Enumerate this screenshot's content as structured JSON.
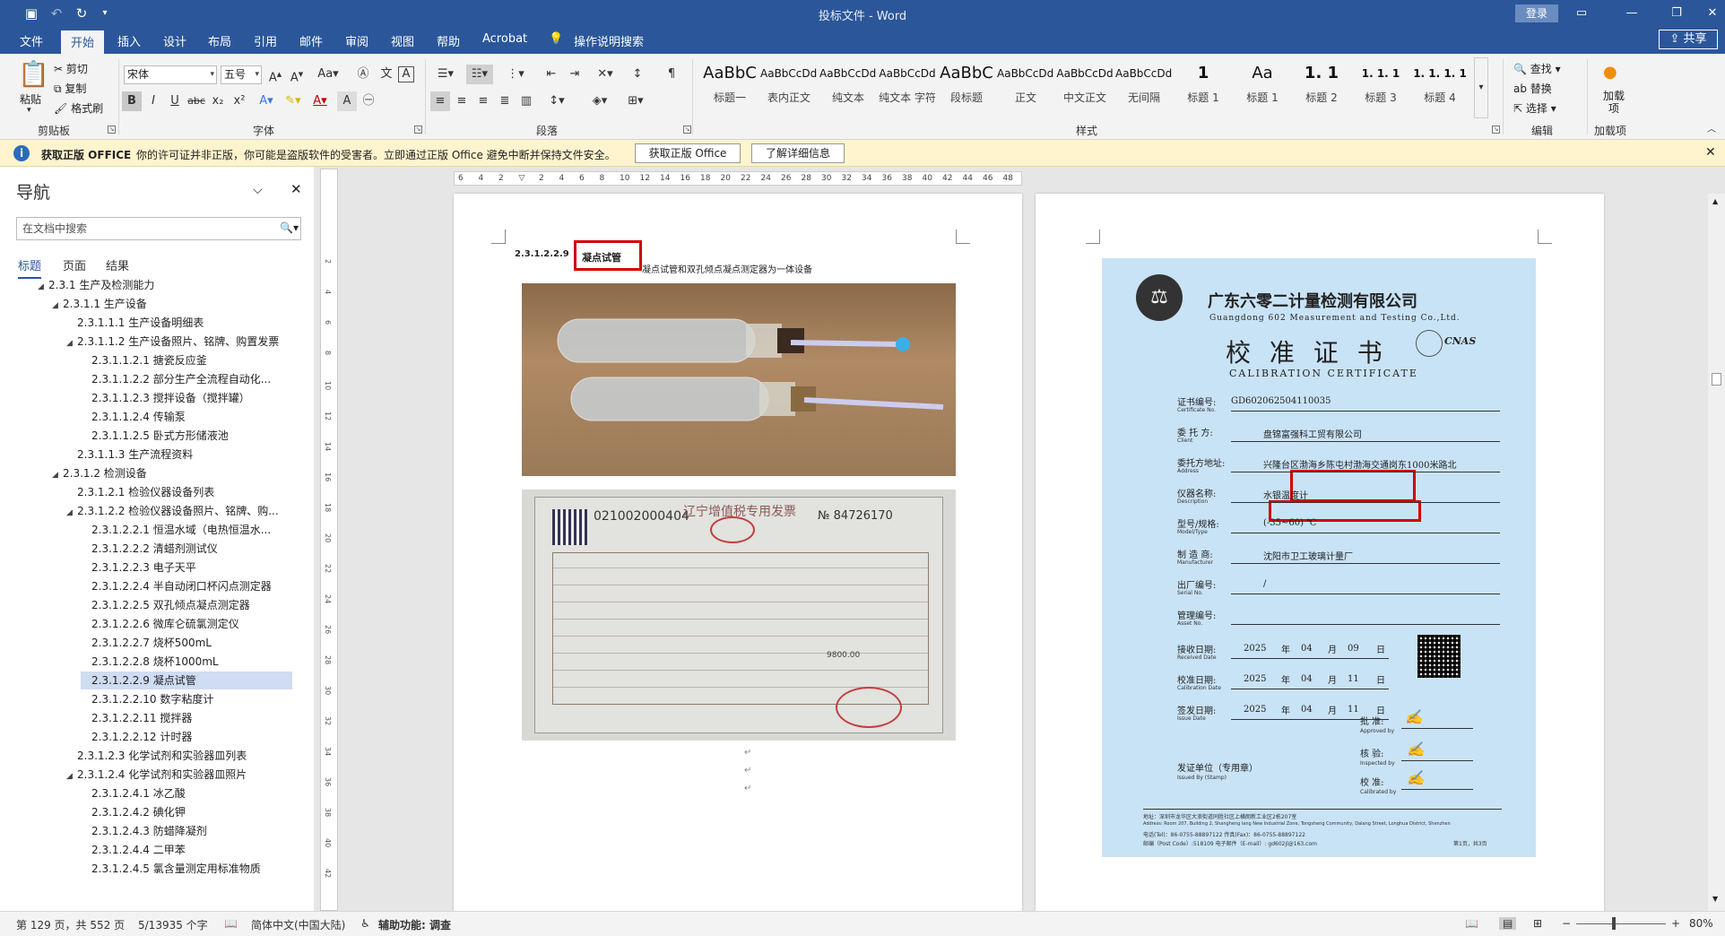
{
  "window": {
    "title": "投标文件 - Word",
    "login": "登录",
    "share": "共享"
  },
  "tabs": [
    "文件",
    "开始",
    "插入",
    "设计",
    "布局",
    "引用",
    "邮件",
    "审阅",
    "视图",
    "帮助",
    "Acrobat",
    "操作说明搜索"
  ],
  "ribbon": {
    "clipboard": {
      "paste": "粘贴",
      "cut": "剪切",
      "copy": "复制",
      "format_painter": "格式刷",
      "label": "剪贴板"
    },
    "font": {
      "name": "宋体",
      "size": "五号",
      "label": "字体"
    },
    "paragraph": {
      "label": "段落"
    },
    "styles": {
      "label": "样式",
      "items": [
        {
          "preview": "AaBbC",
          "name": "标题一"
        },
        {
          "preview": "AaBbCcDdI",
          "name": "表内正文"
        },
        {
          "preview": "AaBbCcDdI",
          "name": "纯文本"
        },
        {
          "preview": "AaBbCcDd",
          "name": "纯文本 字符"
        },
        {
          "preview": "AaBbC",
          "name": "段标题"
        },
        {
          "preview": "AaBbCcDdI",
          "name": "正文"
        },
        {
          "preview": "AaBbCcDd",
          "name": "中文正文"
        },
        {
          "preview": "AaBbCcDdI",
          "name": "无间隔"
        },
        {
          "preview": "1",
          "name": "标题 1"
        },
        {
          "preview": "Aa",
          "name": "标题 1"
        },
        {
          "preview": "1. 1",
          "name": "标题 2"
        },
        {
          "preview": "1. 1. 1",
          "name": "标题 3"
        },
        {
          "preview": "1. 1. 1. 1",
          "name": "标题 4"
        }
      ]
    },
    "editing": {
      "find": "查找",
      "replace": "替换",
      "select": "选择",
      "label": "编辑"
    },
    "addins": {
      "btn": "加载项",
      "label": "加载项"
    }
  },
  "infobar": {
    "title": "获取正版 OFFICE",
    "message": "你的许可证并非正版，你可能是盗版软件的受害者。立即通过正版 Office 避免中断并保持文件安全。",
    "btn1": "获取正版 Office",
    "btn2": "了解详细信息"
  },
  "nav": {
    "title": "导航",
    "search_placeholder": "在文档中搜索",
    "tabs": [
      "标题",
      "页面",
      "结果"
    ],
    "items": [
      {
        "text": "2.3.1 生产及检测能力",
        "level": 1,
        "tri": "▲"
      },
      {
        "text": "2.3.1.1 生产设备",
        "level": 2,
        "tri": "▲"
      },
      {
        "text": "2.3.1.1.1 生产设备明细表",
        "level": 3,
        "tri": ""
      },
      {
        "text": "2.3.1.1.2 生产设备照片、铭牌、购置发票",
        "level": 3,
        "tri": "▲"
      },
      {
        "text": "2.3.1.1.2.1 搪瓷反应釜",
        "level": 4,
        "tri": ""
      },
      {
        "text": "2.3.1.1.2.2 部分生产全流程自动化...",
        "level": 4,
        "tri": ""
      },
      {
        "text": "2.3.1.1.2.3 搅拌设备（搅拌罐）",
        "level": 4,
        "tri": ""
      },
      {
        "text": "2.3.1.1.2.4 传输泵",
        "level": 4,
        "tri": ""
      },
      {
        "text": "2.3.1.1.2.5 卧式方形储液池",
        "level": 4,
        "tri": ""
      },
      {
        "text": "2.3.1.1.3 生产流程资料",
        "level": 3,
        "tri": ""
      },
      {
        "text": "2.3.1.2 检测设备",
        "level": 2,
        "tri": "▲"
      },
      {
        "text": "2.3.1.2.1 检验仪器设备列表",
        "level": 3,
        "tri": ""
      },
      {
        "text": "2.3.1.2.2 检验仪器设备照片、铭牌、购...",
        "level": 3,
        "tri": "▲"
      },
      {
        "text": "2.3.1.2.2.1 恒温水域（电热恒温水...",
        "level": 4,
        "tri": ""
      },
      {
        "text": "2.3.1.2.2.2 清蜡剂测试仪",
        "level": 4,
        "tri": ""
      },
      {
        "text": "2.3.1.2.2.3 电子天平",
        "level": 4,
        "tri": ""
      },
      {
        "text": "2.3.1.2.2.4 半自动闭口杯闪点测定器",
        "level": 4,
        "tri": ""
      },
      {
        "text": "2.3.1.2.2.5 双孔倾点凝点测定器",
        "level": 4,
        "tri": ""
      },
      {
        "text": "2.3.1.2.2.6 微库仑硫氯测定仪",
        "level": 4,
        "tri": ""
      },
      {
        "text": "2.3.1.2.2.7 烧杯500mL",
        "level": 4,
        "tri": ""
      },
      {
        "text": "2.3.1.2.2.8 烧杯1000mL",
        "level": 4,
        "tri": ""
      },
      {
        "text": "2.3.1.2.2.9 凝点试管",
        "level": 4,
        "tri": "",
        "selected": true
      },
      {
        "text": "2.3.1.2.2.10 数字粘度计",
        "level": 4,
        "tri": ""
      },
      {
        "text": "2.3.1.2.2.11 搅拌器",
        "level": 4,
        "tri": ""
      },
      {
        "text": "2.3.1.2.2.12 计时器",
        "level": 4,
        "tri": ""
      },
      {
        "text": "2.3.1.2.3 化学试剂和实验器皿列表",
        "level": 3,
        "tri": ""
      },
      {
        "text": "2.3.1.2.4 化学试剂和实验器皿照片",
        "level": 3,
        "tri": "▲"
      },
      {
        "text": "2.3.1.2.4.1 冰乙酸",
        "level": 4,
        "tri": ""
      },
      {
        "text": "2.3.1.2.4.2 碘化钾",
        "level": 4,
        "tri": ""
      },
      {
        "text": "2.3.1.2.4.3 防蜡降凝剂",
        "level": 4,
        "tri": ""
      },
      {
        "text": "2.3.1.2.4.4 二甲苯",
        "level": 4,
        "tri": ""
      },
      {
        "text": "2.3.1.2.4.5 氯含量测定用标准物质",
        "level": 4,
        "tri": ""
      }
    ]
  },
  "doc": {
    "heading_num": "2.3.1.2.2.9",
    "heading_text": "凝点试管",
    "caption": "凝点试管和双孔倾点凝点测定器为一体设备",
    "invoice": {
      "code": "021002000404",
      "title": "辽宁增值税专用发票",
      "no": "№ 84726170",
      "amount": "9800.00"
    }
  },
  "cert": {
    "company_cn": "广东六零二计量检测有限公司",
    "company_en": "Guangdong 602 Measurement and Testing Co.,Ltd.",
    "title_cn": "校 准 证 书",
    "title_en": "CALIBRATION CERTIFICATE",
    "fields": [
      {
        "label": "证书编号:",
        "sub": "Certificate No.",
        "value": "GD602062504110035"
      },
      {
        "label": "委 托 方:",
        "sub": "Client",
        "value": "盘锦富强科工贸有限公司"
      },
      {
        "label": "委托方地址:",
        "sub": "Address",
        "value": "兴隆台区渤海乡陈屯村渤海交通岗东1000米路北"
      },
      {
        "label": "仪器名称:",
        "sub": "Description",
        "value": "水银温度计"
      },
      {
        "label": "型号/规格:",
        "sub": "Model/Type",
        "value": "(-35~60) ℃"
      },
      {
        "label": "制 造 商:",
        "sub": "Manufacturer",
        "value": "沈阳市卫工玻璃计量厂"
      },
      {
        "label": "出厂编号:",
        "sub": "Serial No.",
        "value": "/"
      },
      {
        "label": "管理编号:",
        "sub": "Asset No.",
        "value": ""
      }
    ],
    "dates": [
      {
        "label": "接收日期:",
        "sub": "Received Date",
        "y": "2025",
        "m": "04",
        "d": "09"
      },
      {
        "label": "校准日期:",
        "sub": "Calibration Date",
        "y": "2025",
        "m": "04",
        "d": "11"
      },
      {
        "label": "签发日期:",
        "sub": "Issue Date",
        "y": "2025",
        "m": "04",
        "d": "11"
      }
    ],
    "sign": {
      "approve": "批 准:",
      "approve_en": "Approved by",
      "inspect": "核 验:",
      "inspect_en": "Inspected by",
      "calib": "校 准:",
      "calib_en": "Calibrated by",
      "issuer": "发证单位（专用章）",
      "issuer_en": "Issued By (Stamp)"
    },
    "footer": [
      "地址：深圳市龙华区大浪街道同胜社区上横朗新工业区2栋207室",
      "Address: Room 207, Building 2, Shangheng lang New Industrial Zone, Tongsheng Community, Dalang Street, Longhua District, Shenzhen",
      "电话(Tel)：86-0755-88897122      传真(Fax)：86-0755-88897122",
      "邮编（Post Code）:518109      电子邮件（E-mail）: gd602jl@163.com"
    ],
    "page": "第1页，共3页"
  },
  "status": {
    "page": "第 129 页，共 552 页",
    "words": "5/13935 个字",
    "lang": "简体中文(中国大陆)",
    "access": "辅助功能: 调查",
    "zoom": "80%"
  }
}
